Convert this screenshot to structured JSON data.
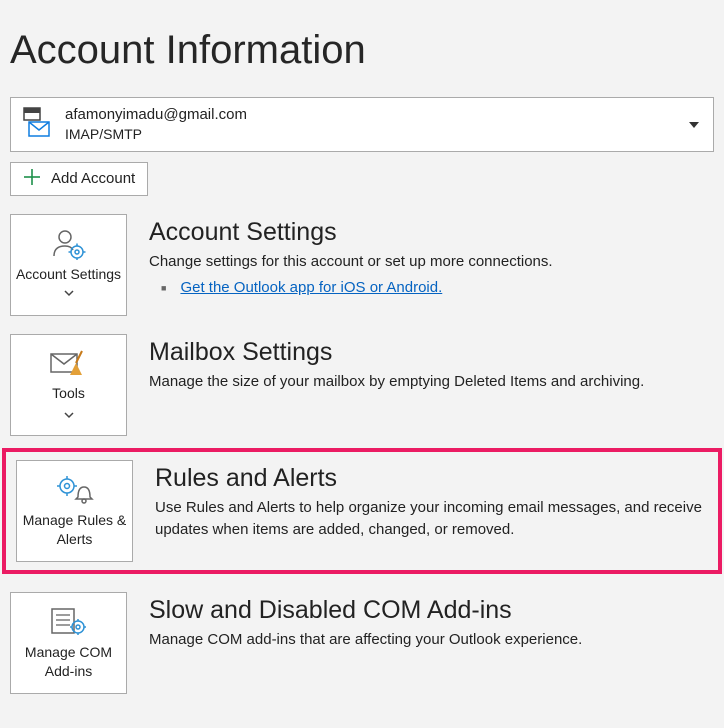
{
  "page": {
    "title": "Account Information"
  },
  "account_selector": {
    "email": "afamonyimadu@gmail.com",
    "type": "IMAP/SMTP"
  },
  "add_account": {
    "label": "Add Account"
  },
  "sections": {
    "account_settings": {
      "tile_label": "Account Settings",
      "title": "Account Settings",
      "desc": "Change settings for this account or set up more connections.",
      "link": "Get the Outlook app for iOS or Android."
    },
    "mailbox_settings": {
      "tile_label": "Tools",
      "title": "Mailbox Settings",
      "desc": "Manage the size of your mailbox by emptying Deleted Items and archiving."
    },
    "rules_alerts": {
      "tile_label": "Manage Rules & Alerts",
      "title": "Rules and Alerts",
      "desc": "Use Rules and Alerts to help organize your incoming email messages, and receive updates when items are added, changed, or removed."
    },
    "com_addins": {
      "tile_label": "Manage COM Add-ins",
      "title": "Slow and Disabled COM Add-ins",
      "desc": "Manage COM add-ins that are affecting your Outlook experience."
    }
  }
}
